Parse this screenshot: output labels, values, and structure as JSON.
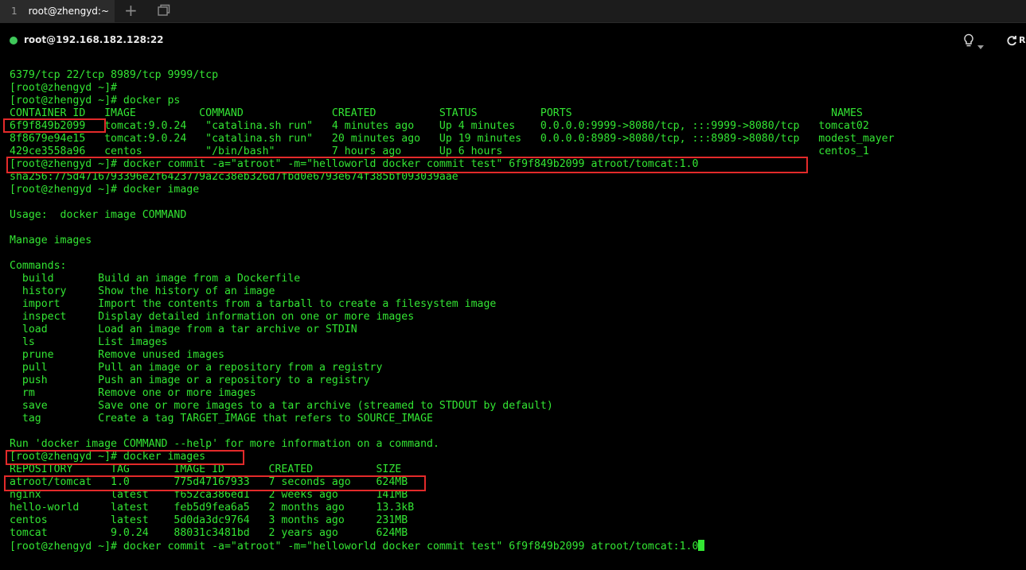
{
  "tab": {
    "number": "1",
    "title": "root@zhengyd:~"
  },
  "session": {
    "title": "root@192.168.182.128:22",
    "refresh_label": "R"
  },
  "icons": {
    "new_tab": "plus-icon",
    "tab_manager": "tabs-icon",
    "hint": "lightbulb-icon",
    "dropdown": "chevron-down-icon",
    "refresh": "refresh-icon"
  },
  "colors": {
    "terminal_text": "#33e533",
    "terminal_bg": "#000000",
    "highlight": "#e32a2a",
    "status_online": "#3fc85a"
  },
  "terminal": {
    "lines": [
      "6379/tcp 22/tcp 8989/tcp 9999/tcp",
      "[root@zhengyd ~]#",
      "[root@zhengyd ~]# docker ps",
      "CONTAINER ID   IMAGE          COMMAND              CREATED          STATUS          PORTS                                         NAMES",
      "6f9f849b2099   tomcat:9.0.24   \"catalina.sh run\"   4 minutes ago    Up 4 minutes    0.0.0.0:9999->8080/tcp, :::9999->8080/tcp   tomcat02",
      "8f8679e94e15   tomcat:9.0.24   \"catalina.sh run\"   20 minutes ago   Up 19 minutes   0.0.0.0:8989->8080/tcp, :::8989->8080/tcp   modest_mayer",
      "429ce3558a96   centos          \"/bin/bash\"         7 hours ago      Up 6 hours                                                  centos_1",
      "[root@zhengyd ~]# docker commit -a=\"atroot\" -m=\"helloworld docker commit test\" 6f9f849b2099 atroot/tomcat:1.0",
      "sha256:775d4716793396e2f6423779a2c38eb326d7fbd0e6793e674f385bf093039aae",
      "[root@zhengyd ~]# docker image",
      "",
      "Usage:  docker image COMMAND",
      "",
      "Manage images",
      "",
      "Commands:",
      "  build       Build an image from a Dockerfile",
      "  history     Show the history of an image",
      "  import      Import the contents from a tarball to create a filesystem image",
      "  inspect     Display detailed information on one or more images",
      "  load        Load an image from a tar archive or STDIN",
      "  ls          List images",
      "  prune       Remove unused images",
      "  pull        Pull an image or a repository from a registry",
      "  push        Push an image or a repository to a registry",
      "  rm          Remove one or more images",
      "  save        Save one or more images to a tar archive (streamed to STDOUT by default)",
      "  tag         Create a tag TARGET_IMAGE that refers to SOURCE_IMAGE",
      "",
      "Run 'docker image COMMAND --help' for more information on a command.",
      "[root@zhengyd ~]# docker images",
      "REPOSITORY      TAG       IMAGE ID       CREATED          SIZE",
      "atroot/tomcat   1.0       775d47167933   7 seconds ago    624MB",
      "nginx           latest    f652ca386ed1   2 weeks ago      141MB",
      "hello-world     latest    feb5d9fea6a5   2 months ago     13.3kB",
      "centos          latest    5d0da3dc9764   3 months ago     231MB",
      "tomcat          9.0.24    88031c3481bd   2 years ago      624MB"
    ],
    "prompt_line": "[root@zhengyd ~]# docker commit -a=\"atroot\" -m=\"helloworld docker commit test\" 6f9f849b2099 atroot/tomcat:1.0"
  }
}
